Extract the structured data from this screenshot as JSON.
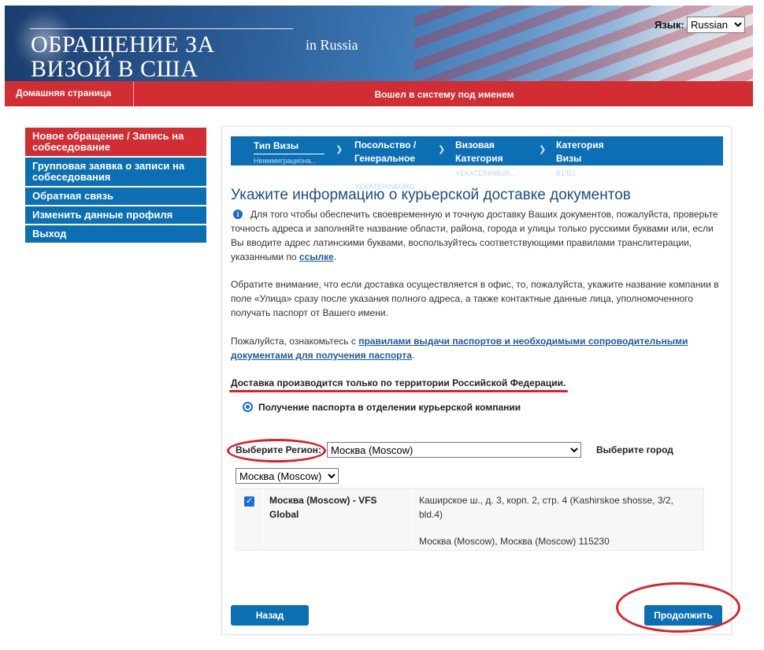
{
  "header": {
    "title": "ОБРАЩЕНИЕ ЗА ВИЗОЙ В США",
    "country": "in  Russia",
    "language_label": "Язык:",
    "language_value": "Russian"
  },
  "topnav": {
    "home": "Домашняя страница",
    "logged_in": "Вошел в систему под именем"
  },
  "sidebar": {
    "items": [
      {
        "label": "Новое обращение / Запись на собеседование"
      },
      {
        "label": "Групповая заявка о записи на собеседования"
      },
      {
        "label": "Обратная связь"
      },
      {
        "label": "Изменить данные профиля"
      },
      {
        "label": "Выход"
      }
    ]
  },
  "steps": [
    {
      "title": "Тип Визы",
      "sub": "Неиммиграциона..."
    },
    {
      "title": "Посольство / Генеральное Консульство",
      "sub": "YEKATERINBURG"
    },
    {
      "title": "Визовая Категория",
      "sub": "YEKATERINBUR..."
    },
    {
      "title": "Категория Визы",
      "sub": "B1/B2"
    }
  ],
  "content": {
    "heading": "Укажите информацию о курьерской доставке документов",
    "para1_text": "Для того чтобы обеспечить своевременную и точную доставку Ваших документов, пожалуйста, проверьте точность адреса и заполняйте название области, района, города и улицы только русскими буквами или, если Вы вводите адрес латинскими буквами, воспользуйтесь соответствующими правилами транслитерации, указанными по",
    "para1_link": "ссылке",
    "para2": "Обратите внимание, что если доставка осуществляется в офис, то, пожалуйста, укажите название компании в поле «Улица» сразу после указания полного адреса, а также контактные данные лица, уполномоченного получать паспорт от Вашего имени.",
    "para3_text": "Пожалуйста, ознакомьтесь с",
    "para3_link": "правилами выдачи паспортов и необходимыми сопроводительными документами для получения паспорта",
    "delivery_note": "Доставка производится только по территории Российской Федерации.",
    "radio_label": "Получение паспорта в отделении курьерской компании",
    "region_label": "Выберите Регион:",
    "region_value": "Москва (Moscow)",
    "city_label": "Выберите город",
    "city_value": "Москва (Moscow)",
    "office": {
      "name": "Москва (Moscow) - VFS Global",
      "address": "Каширское ш., д. 3, корп. 2, стр. 4 (Kashirskoe shosse, 3/2, bld.4)",
      "city": "Москва (Moscow), Москва (Moscow) 115230"
    },
    "back_label": "Назад",
    "next_label": "Продолжить"
  },
  "colors": {
    "brand_blue": "#0d6fb3",
    "brand_red": "#d22d33",
    "annotation_red": "#d8222b"
  }
}
